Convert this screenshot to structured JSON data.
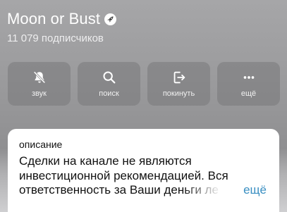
{
  "channel": {
    "name": "Moon or Bust",
    "subscribers": "11 079 подписчиков",
    "badge_icon": "rocket-icon"
  },
  "actions": [
    {
      "label": "звук",
      "icon": "bell-slash-icon"
    },
    {
      "label": "поиск",
      "icon": "search-icon"
    },
    {
      "label": "покинуть",
      "icon": "leave-icon"
    },
    {
      "label": "ещё",
      "icon": "more-icon"
    }
  ],
  "description": {
    "heading": "описание",
    "text": "Сделки на канале не являются инвестиционной рекомендацией. Вся ответственность за Ваши деньги ле",
    "more_label": "ещё"
  },
  "colors": {
    "accent": "#3a8fc2",
    "action_bg": "#78787a"
  }
}
